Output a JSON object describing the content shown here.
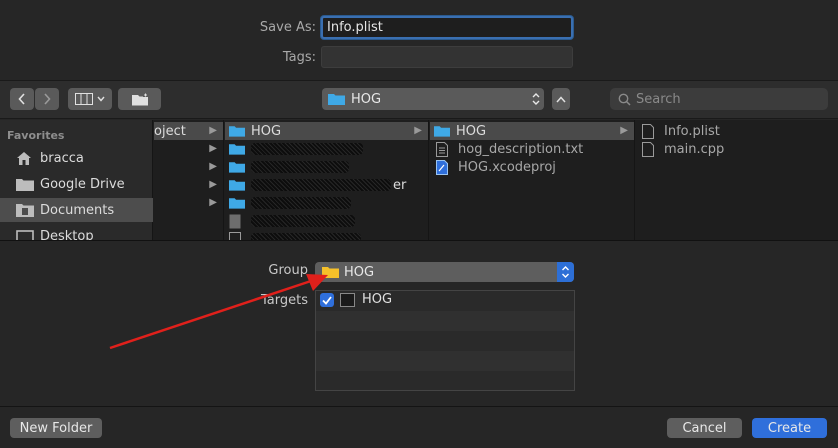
{
  "form": {
    "save_as_label": "Save As:",
    "save_as_value": "Info.plist",
    "tags_label": "Tags:",
    "tags_value": ""
  },
  "toolbar": {
    "back_icon": "chevron-left-icon",
    "forward_icon": "chevron-right-icon",
    "view_icon": "columns-view-icon",
    "new_folder_icon": "folder-badge-icon",
    "path_folder": "HOG",
    "search_placeholder": "Search"
  },
  "sidebar": {
    "heading": "Favorites",
    "items": [
      {
        "label": "bracca",
        "icon": "home-icon",
        "selected": false
      },
      {
        "label": "Google Drive",
        "icon": "folder-icon",
        "selected": false
      },
      {
        "label": "Documents",
        "icon": "documents-icon",
        "selected": true
      },
      {
        "label": "Desktop",
        "icon": "desktop-icon",
        "selected": false
      }
    ]
  },
  "columns": {
    "col1": {
      "items": [
        {
          "label": "oject",
          "selected": true
        }
      ]
    },
    "col2": {
      "items": [
        {
          "label": "HOG",
          "selected": true
        },
        {
          "label": "",
          "redacted": true
        },
        {
          "label": "",
          "redacted": true,
          "suffix": "er"
        },
        {
          "label": "",
          "redacted": true
        },
        {
          "label": "",
          "redacted": true
        }
      ]
    },
    "col3": {
      "items": [
        {
          "label": "HOG",
          "selected": true,
          "icon": "folder-icon"
        },
        {
          "label": "hog_description.txt",
          "icon": "text-file-icon"
        },
        {
          "label": "HOG.xcodeproj",
          "icon": "xcodeproj-icon"
        }
      ]
    },
    "col4": {
      "items": [
        {
          "label": "Info.plist",
          "icon": "file-icon"
        },
        {
          "label": "main.cpp",
          "icon": "file-icon"
        }
      ]
    }
  },
  "group": {
    "label": "Group",
    "value": "HOG"
  },
  "targets": {
    "label": "Targets",
    "items": [
      {
        "label": "HOG",
        "checked": true
      }
    ]
  },
  "buttons": {
    "new_folder": "New Folder",
    "cancel": "Cancel",
    "create": "Create"
  },
  "colors": {
    "accent": "#2f6fdb",
    "folder_blue": "#3fa9e6",
    "folder_yellow": "#f6c12a",
    "annotation_arrow": "#e0201b"
  }
}
